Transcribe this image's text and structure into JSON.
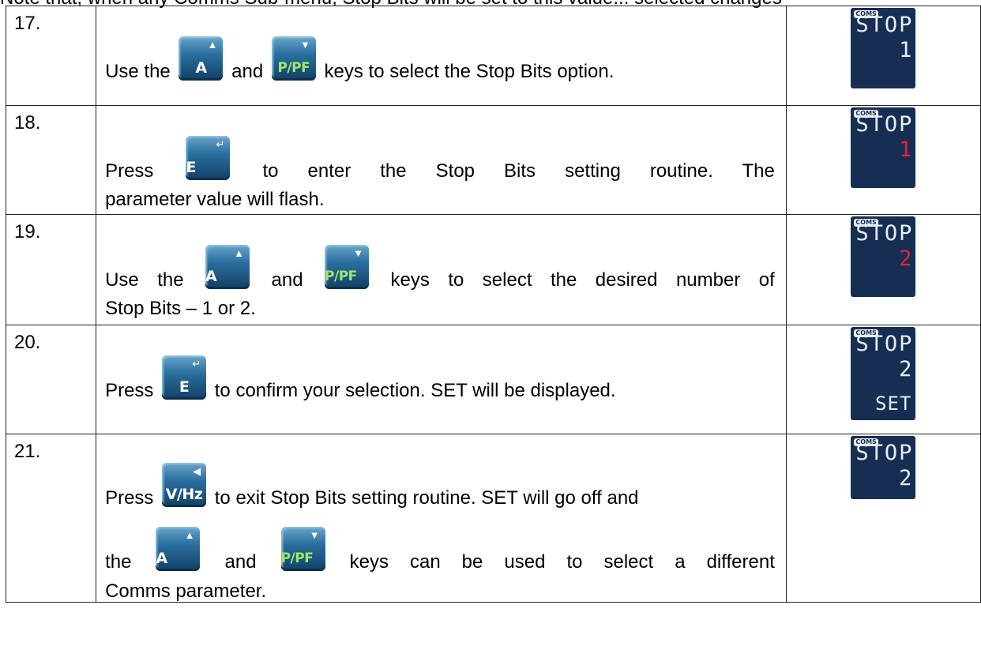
{
  "header_fragment": "Note that, when any Comms Sub-menu, Stop Bits will be set to this value... selected changes",
  "keys": {
    "a": "A",
    "p": "P/PF",
    "e": "E",
    "v": "V/Hz"
  },
  "display": {
    "badge": "COMS",
    "title": "STOP",
    "set": "SET"
  },
  "steps": [
    {
      "num": "17.",
      "t1": "Use the",
      "t2": "and",
      "t3": "keys to select the Stop Bits option.",
      "val": "1"
    },
    {
      "num": "18.",
      "t1": "Press",
      "t2": "to enter the Stop Bits setting routine.",
      "t3": "The",
      "t4": "parameter value will flash.",
      "val": "1"
    },
    {
      "num": "19.",
      "t1": "Use the",
      "t2": "and",
      "t3": "keys to select the desired number of",
      "t4": "Stop Bits – 1 or 2.",
      "val": "2"
    },
    {
      "num": "20.",
      "t1": "Press",
      "t2": "to confirm your selection.  SET will be displayed.",
      "val": "2"
    },
    {
      "num": "21.",
      "t1": "Press",
      "t2": "to exit Stop Bits setting routine.  SET will go off and",
      "t3": "the",
      "t4": "and",
      "t5": "keys can be used to select a different",
      "t6": "Comms parameter.",
      "val": "2"
    }
  ]
}
